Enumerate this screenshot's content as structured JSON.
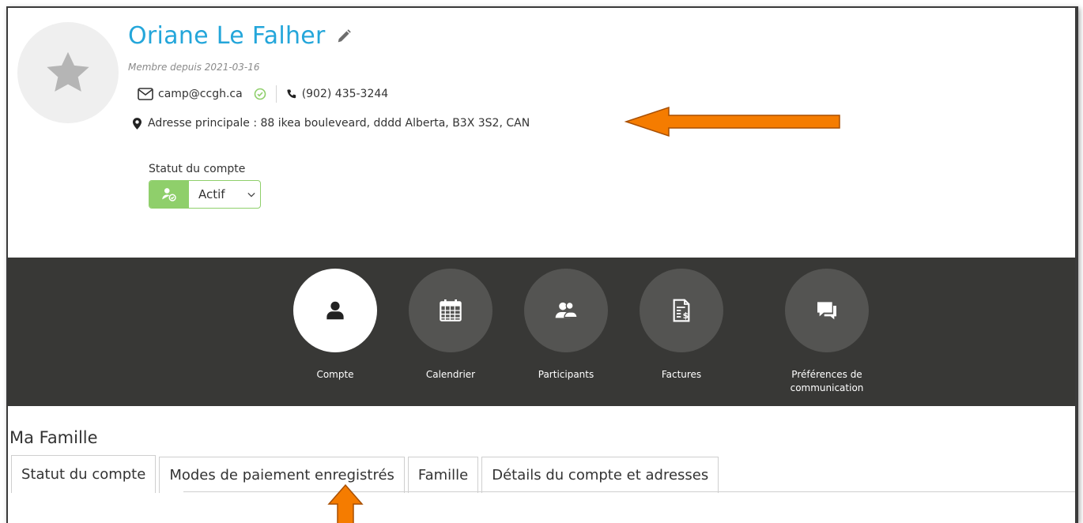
{
  "profile": {
    "name": "Oriane Le Falher",
    "member_since": "Membre depuis 2021-03-16",
    "email": "camp@ccgh.ca",
    "phone": "(902) 435-3244",
    "address": "Adresse principale : 88 ikea bouleveard, dddd Alberta, B3X 3S2, CAN"
  },
  "account_status": {
    "label": "Statut du compte",
    "value": "Actif"
  },
  "nav": {
    "items": [
      {
        "label": "Compte",
        "icon": "user-icon",
        "active": true
      },
      {
        "label": "Calendrier",
        "icon": "calendar-icon",
        "active": false
      },
      {
        "label": "Participants",
        "icon": "users-icon",
        "active": false
      },
      {
        "label": "Factures",
        "icon": "invoice-icon",
        "active": false
      },
      {
        "label": "Préférences de communication",
        "icon": "chat-icon",
        "active": false
      }
    ]
  },
  "section": {
    "title": "Ma Famille",
    "tabs": [
      {
        "label": "Statut du compte",
        "active": true
      },
      {
        "label": "Modes de paiement enregistrés",
        "active": false
      },
      {
        "label": "Famille",
        "active": false
      },
      {
        "label": "Détails du compte et adresses",
        "active": false
      }
    ]
  },
  "colors": {
    "brand_blue": "#24a6da",
    "status_green": "#8fcf6b",
    "nav_background": "#383836",
    "annotation_arrow": "#f57c00"
  }
}
